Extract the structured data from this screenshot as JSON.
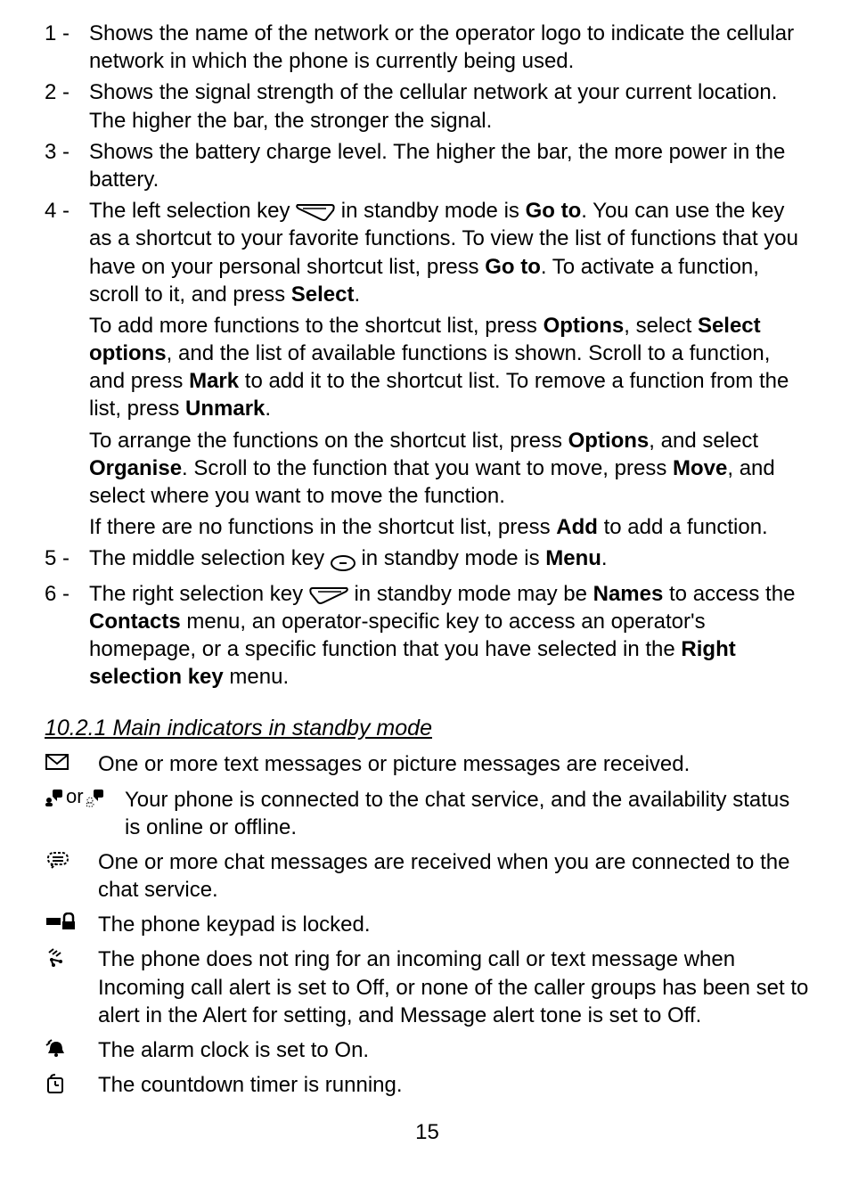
{
  "items": [
    {
      "num": "1 -",
      "body_html": "Shows the name of the network or the operator logo to indicate the cellular network in which the phone is currently being used."
    },
    {
      "num": "2 -",
      "body_html": "Shows the signal strength of the cellular network at your current location. The higher the bar, the stronger the signal."
    },
    {
      "num": "3 -",
      "body_html": "Shows the battery charge level. The higher the bar, the more power in the battery."
    },
    {
      "num": "4 -",
      "body_html": "The left selection key {LEFTKEY} in standby mode is <b>Go to</b>. You can use the key as a shortcut to your favorite functions. To view the list of functions that you have on your personal shortcut list, press <b>Go to</b>. To activate a function, scroll to it, and press <b>Select</b>.",
      "paras": [
        "To add more functions to the shortcut list, press <b>Options</b>, select <b>Select options</b>, and the list of available functions is shown. Scroll to a function, and press <b>Mark</b> to add it to the shortcut list. To remove a function from the list, press <b>Unmark</b>.",
        "To arrange the functions on the shortcut list, press <b>Options</b>, and select <b>Organise</b>. Scroll to the function that you want to move, press <b>Move</b>, and select where you want to move the function.",
        "If there are no functions in the shortcut list, press <b>Add</b> to add a function."
      ]
    },
    {
      "num": "5 -",
      "body_html": "The middle selection key {MIDKEY} in standby mode is <b>Menu</b>."
    },
    {
      "num": "6 -",
      "body_html": "The right selection key {RIGHTKEY} in standby mode may be <b>Names</b> to access the <b>Contacts</b> menu, an operator-specific key to access an operator's homepage, or a specific function that you have selected in the <b>Right selection key</b> menu."
    }
  ],
  "section_heading": "10.2.1 Main indicators in standby mode",
  "indicators": [
    {
      "icon": "envelope",
      "text": "One or more text messages or picture messages are received."
    },
    {
      "icon": "chat-status-pair",
      "text": "Your phone is connected to the chat service, and the availability status is online or offline."
    },
    {
      "icon": "chat-msg",
      "text": "One or more chat messages are received when you are connected to the chat service."
    },
    {
      "icon": "lock",
      "text": "The phone keypad is locked."
    },
    {
      "icon": "silent",
      "text": "The phone does not ring for an incoming call or text message when Incoming call alert is set to Off, or none of the caller groups has been set to alert in the Alert for setting, and Message alert tone is set to Off."
    },
    {
      "icon": "alarm",
      "text": "The alarm clock is set to On."
    },
    {
      "icon": "timer",
      "text": "The countdown timer is running."
    }
  ],
  "chat_status_or": "or",
  "page_number": "15"
}
